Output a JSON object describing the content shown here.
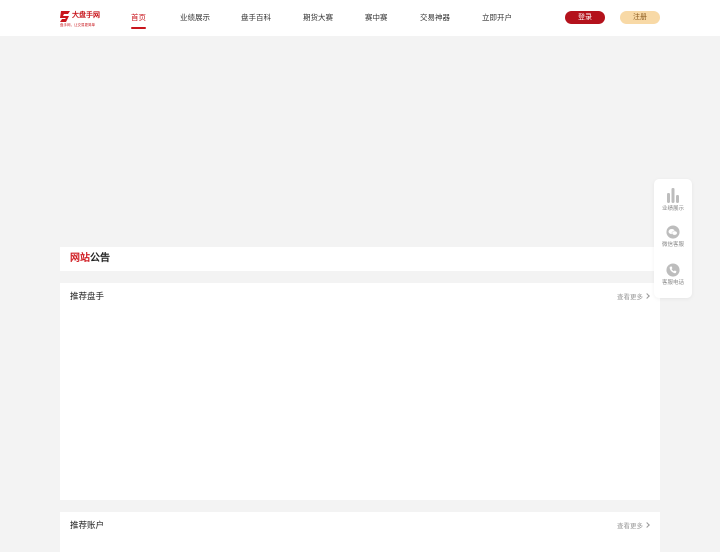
{
  "header": {
    "logo": {
      "title": "大盘手网",
      "slogan": "盘手网，让交易更简单"
    },
    "nav": [
      {
        "label": "首页",
        "active": true
      },
      {
        "label": "业绩展示",
        "active": false
      },
      {
        "label": "盘手百科",
        "active": false
      },
      {
        "label": "期货大赛",
        "active": false
      },
      {
        "label": "赛中赛",
        "active": false
      },
      {
        "label": "交易神器",
        "active": false
      },
      {
        "label": "立即开户",
        "active": false
      }
    ],
    "login_label": "登录",
    "register_label": "注册"
  },
  "notice": {
    "title_red": "网站",
    "title_dark": "公告"
  },
  "sections": {
    "recommended_traders": {
      "title": "推荐盘手",
      "more": "查看更多"
    },
    "recommended_accounts": {
      "title": "推荐账户",
      "more": "查看更多"
    }
  },
  "side_panel": {
    "items": [
      {
        "label": "业绩展示",
        "icon": "bar-chart-icon"
      },
      {
        "label": "微信客服",
        "icon": "wechat-icon"
      },
      {
        "label": "客服电话",
        "icon": "phone-icon"
      }
    ]
  },
  "colors": {
    "brand_red": "#c8161d",
    "login_bg": "#b4121c",
    "register_bg": "#f8d9a6",
    "page_bg": "#f3f3f3"
  }
}
